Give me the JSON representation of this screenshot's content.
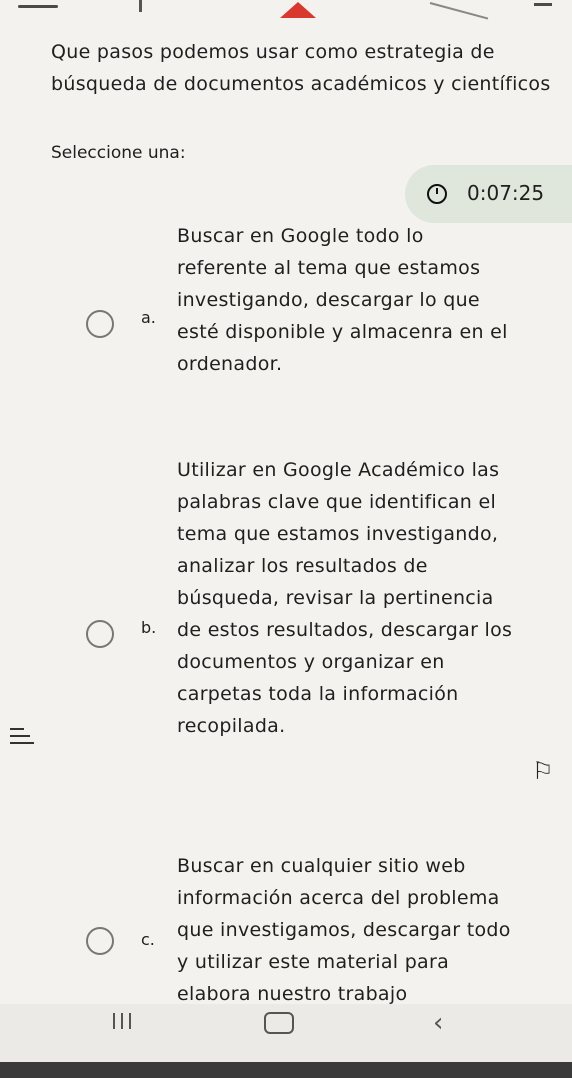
{
  "question": {
    "title": "Que pasos podemos usar como estrategia de búsqueda de documentos académicos y científicos",
    "prompt": "Seleccione una:"
  },
  "timer": {
    "time": "0:07:25"
  },
  "options": [
    {
      "letter": "a.",
      "text": "Buscar en Google todo lo referente al tema que estamos investigando, descargar lo que esté disponible y almacenra en el ordenador."
    },
    {
      "letter": "b.",
      "text": "Utilizar en Google Académico las palabras clave que identifican el tema que estamos investigando, analizar los resultados de búsqueda, revisar la pertinencia de estos resultados, descargar los documentos y organizar en carpetas toda la información recopilada."
    },
    {
      "letter": "c.",
      "text": "Buscar en cualquier sitio web información acerca del problema que investigamos, descargar todo y utilizar este material para elabora nuestro trabajo"
    }
  ],
  "icons": {
    "clock": "clock-icon",
    "handle": "menu-handle-icon",
    "flag": "flag-icon",
    "recents": "recents-icon",
    "home": "home-icon",
    "back": "back-icon"
  }
}
